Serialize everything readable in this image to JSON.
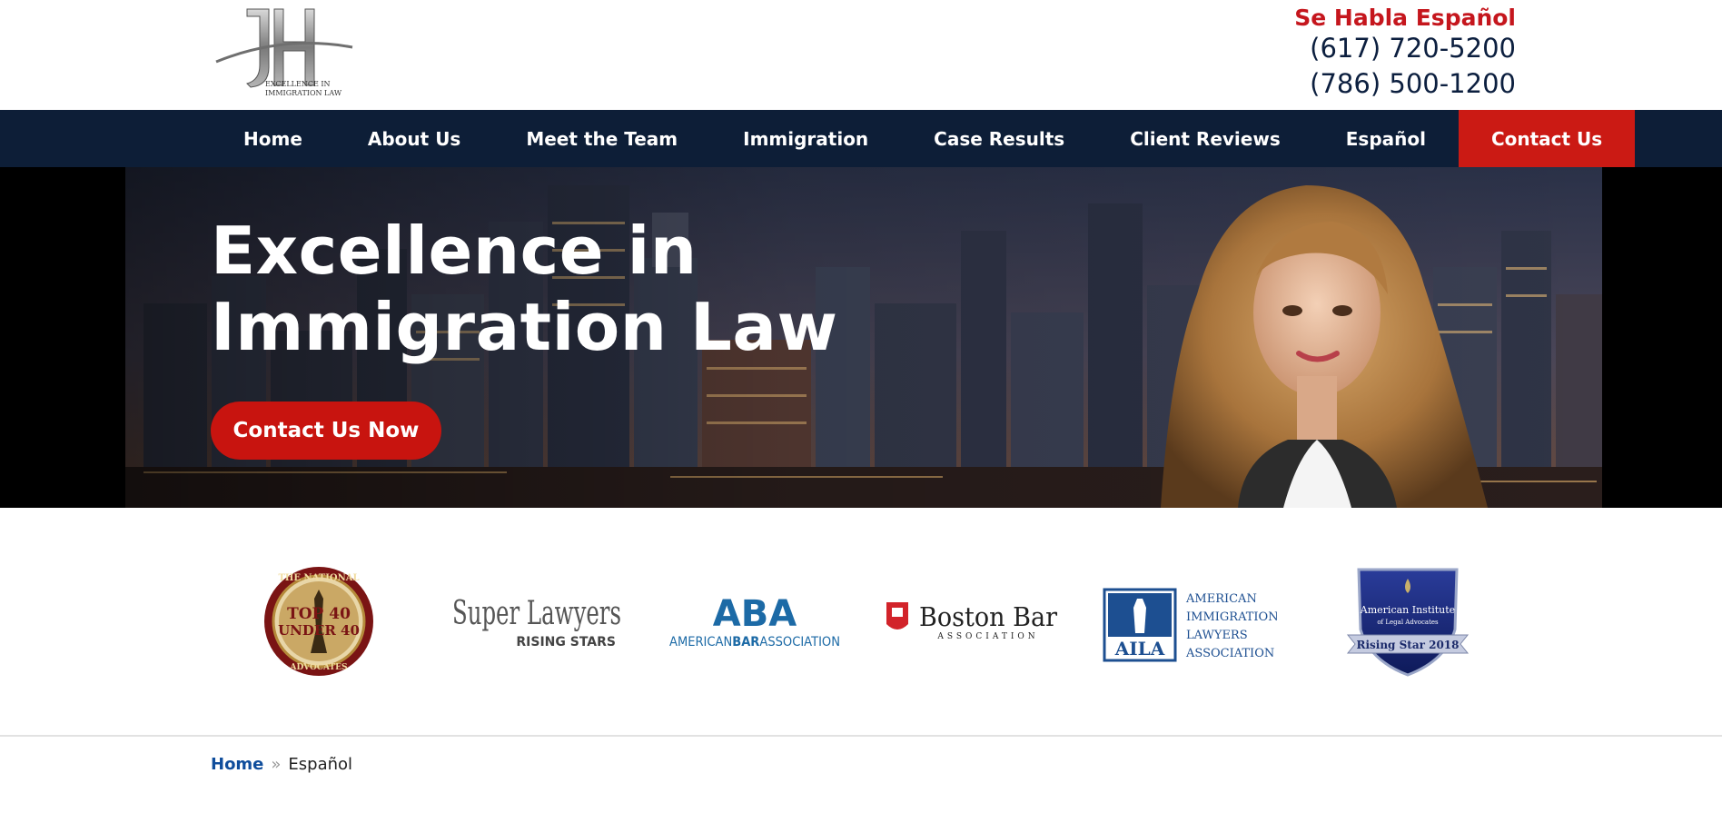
{
  "header": {
    "logo_alt": "Excellence in Immigration Law",
    "logo_line1": "EXCELLENCE IN",
    "logo_line2": "IMMIGRATION LAW",
    "habla": "Se Habla Español",
    "phone1": "(617) 720-5200",
    "phone2": "(786) 500-1200"
  },
  "nav": {
    "items": [
      {
        "label": "Home"
      },
      {
        "label": "About Us"
      },
      {
        "label": "Meet the Team"
      },
      {
        "label": "Immigration"
      },
      {
        "label": "Case Results"
      },
      {
        "label": "Client Reviews"
      },
      {
        "label": "Español"
      },
      {
        "label": "Contact Us"
      }
    ]
  },
  "hero": {
    "title_line1": "Excellence in",
    "title_line2": "Immigration Law",
    "cta": "Contact Us Now"
  },
  "badges": {
    "national": {
      "top": "THE NATIONAL",
      "mid1": "TOP 40",
      "mid2": "UNDER 40",
      "bottom": "ADVOCATES"
    },
    "superlawyers": {
      "main": "Super Lawyers",
      "sub": "RISING STARS"
    },
    "aba": {
      "mark": "ABA",
      "pre": "AMERICAN",
      "bold": "BAR",
      "post": "ASSOCIATION"
    },
    "boston": {
      "main": "Boston Bar",
      "sub": "ASSOCIATION"
    },
    "aila": {
      "mark": "AILA",
      "l1": "AMERICAN",
      "l2": "IMMIGRATION",
      "l3": "LAWYERS",
      "l4": "ASSOCIATION"
    },
    "institute": {
      "l1": "American Institute",
      "l2": "of Legal Advocates",
      "ribbon": "Rising Star 2018"
    }
  },
  "breadcrumb": {
    "home": "Home",
    "separator": "»",
    "current": "Español"
  },
  "colors": {
    "navy": "#0d1e37",
    "red": "#c8140f",
    "link_blue": "#0f4d9c"
  }
}
